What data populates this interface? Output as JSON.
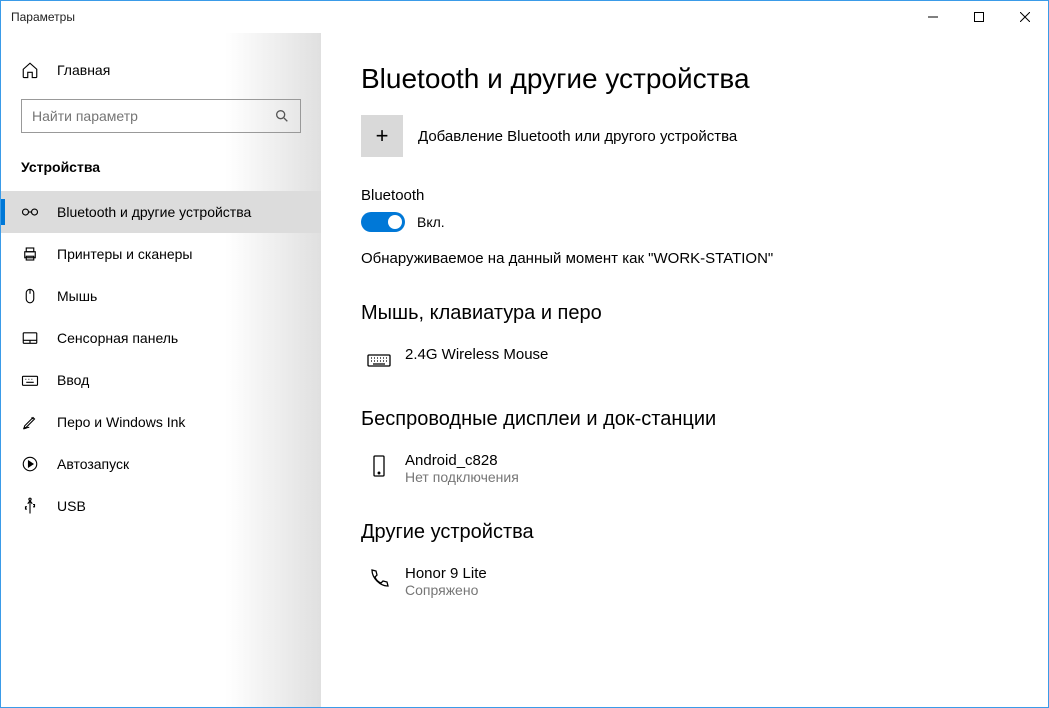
{
  "window": {
    "title": "Параметры"
  },
  "sidebar": {
    "home": "Главная",
    "search_placeholder": "Найти параметр",
    "section": "Устройства",
    "items": [
      {
        "label": "Bluetooth и другие устройства"
      },
      {
        "label": "Принтеры и сканеры"
      },
      {
        "label": "Мышь"
      },
      {
        "label": "Сенсорная панель"
      },
      {
        "label": "Ввод"
      },
      {
        "label": "Перо и Windows Ink"
      },
      {
        "label": "Автозапуск"
      },
      {
        "label": "USB"
      }
    ]
  },
  "page": {
    "title": "Bluetooth и другие устройства",
    "add_device": "Добавление Bluetooth или другого устройства",
    "bluetooth_label": "Bluetooth",
    "bluetooth_state": "Вкл.",
    "discoverable": "Обнаруживаемое на данный момент как \"WORK-STATION\"",
    "group_mouse": "Мышь, клавиатура и перо",
    "device_mouse": {
      "name": "2.4G Wireless Mouse"
    },
    "group_wireless": "Беспроводные дисплеи и док-станции",
    "device_android": {
      "name": "Android_c828",
      "status": "Нет подключения"
    },
    "group_other": "Другие устройства",
    "device_honor": {
      "name": "Honor 9 Lite",
      "status": "Сопряжено"
    }
  }
}
